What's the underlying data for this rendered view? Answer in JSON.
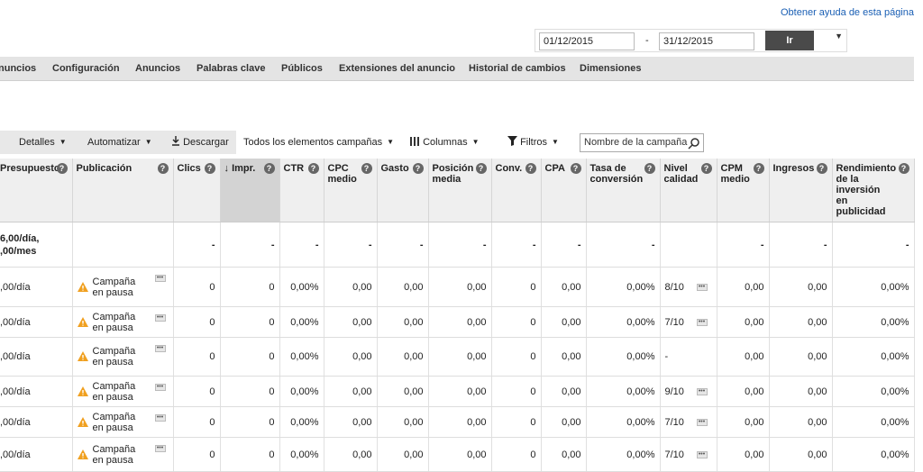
{
  "help_link": "Obtener ayuda de esta página",
  "date_range": {
    "start": "01/12/2015",
    "separator": "-",
    "end": "31/12/2015",
    "go_label": "Ir"
  },
  "nav": [
    "nuncios",
    "Configuración",
    "Anuncios",
    "Palabras clave",
    "Públicos",
    "Extensiones del anuncio",
    "Historial de cambios",
    "Dimensiones"
  ],
  "toolbar": {
    "details": "Detalles",
    "automate": "Automatizar",
    "download": "Descargar",
    "filter_scope": "Todos los elementos campañas",
    "columns": "Columnas",
    "filters": "Filtros",
    "search_value": "Nombre de la campaña"
  },
  "columns": [
    "Presupuesto",
    "Publicación",
    "Clics",
    "Impr.",
    "CTR",
    "CPC medio",
    "Gasto",
    "Posición media",
    "Conv.",
    "CPA",
    "Tasa de conversión",
    "Nivel calidad",
    "CPM medio",
    "Ingresos",
    "Rendimiento de la inversión en publicidad"
  ],
  "summary": {
    "budget_line1": "6,00/día,",
    "budget_line2": ",00/mes",
    "cells": [
      "",
      "-",
      "-",
      "-",
      "-",
      "-",
      "-",
      "-",
      "-",
      "-",
      "",
      "-",
      "-",
      "-"
    ]
  },
  "rows": [
    {
      "budget": ",00/día",
      "status": "Campaña en pausa",
      "clicks": "0",
      "impr": "0",
      "ctr": "0,00%",
      "cpc": "0,00",
      "spend": "0,00",
      "pos": "0,00",
      "conv": "0",
      "cpa": "0,00",
      "conv_rate": "0,00%",
      "quality": "8/10",
      "cpm": "0,00",
      "income": "0,00",
      "roas": "0,00%"
    },
    {
      "budget": ",00/día",
      "status": "Campaña en pausa",
      "clicks": "0",
      "impr": "0",
      "ctr": "0,00%",
      "cpc": "0,00",
      "spend": "0,00",
      "pos": "0,00",
      "conv": "0",
      "cpa": "0,00",
      "conv_rate": "0,00%",
      "quality": "7/10",
      "cpm": "0,00",
      "income": "0,00",
      "roas": "0,00%"
    },
    {
      "budget": ",00/día",
      "status": "Campaña en pausa",
      "clicks": "0",
      "impr": "0",
      "ctr": "0,00%",
      "cpc": "0,00",
      "spend": "0,00",
      "pos": "0,00",
      "conv": "0",
      "cpa": "0,00",
      "conv_rate": "0,00%",
      "quality": "-",
      "cpm": "0,00",
      "income": "0,00",
      "roas": "0,00%"
    },
    {
      "budget": ",00/día",
      "status": "Campaña en pausa",
      "clicks": "0",
      "impr": "0",
      "ctr": "0,00%",
      "cpc": "0,00",
      "spend": "0,00",
      "pos": "0,00",
      "conv": "0",
      "cpa": "0,00",
      "conv_rate": "0,00%",
      "quality": "9/10",
      "cpm": "0,00",
      "income": "0,00",
      "roas": "0,00%"
    },
    {
      "budget": ",00/día",
      "status": "Campaña en pausa",
      "clicks": "0",
      "impr": "0",
      "ctr": "0,00%",
      "cpc": "0,00",
      "spend": "0,00",
      "pos": "0,00",
      "conv": "0",
      "cpa": "0,00",
      "conv_rate": "0,00%",
      "quality": "7/10",
      "cpm": "0,00",
      "income": "0,00",
      "roas": "0,00%"
    },
    {
      "budget": ",00/día",
      "status": "Campaña en pausa",
      "clicks": "0",
      "impr": "0",
      "ctr": "0,00%",
      "cpc": "0,00",
      "spend": "0,00",
      "pos": "0,00",
      "conv": "0",
      "cpa": "0,00",
      "conv_rate": "0,00%",
      "quality": "7/10",
      "cpm": "0,00",
      "income": "0,00",
      "roas": "0,00%"
    }
  ],
  "colors": {
    "link": "#1a5fb4",
    "header_bg": "#efefef",
    "sorted_bg": "#d3d3d3",
    "warning": "#f0a020",
    "nav_bg": "#e4e4e4"
  }
}
